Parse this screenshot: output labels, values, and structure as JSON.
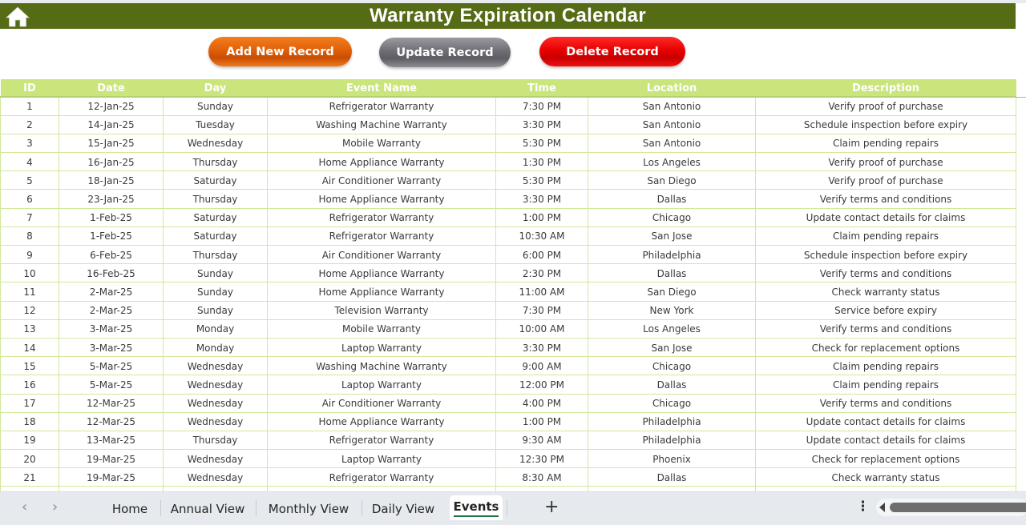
{
  "header": {
    "title": "Warranty Expiration Calendar",
    "home_icon": "home-icon",
    "colors": {
      "title_bar": "#556b15",
      "table_header": "#c9e57c",
      "grid_line": "#d2e89a"
    }
  },
  "toolbar": {
    "add_label": "Add New Record",
    "update_label": "Update Record",
    "delete_label": "Delete Record",
    "colors": {
      "add": "#e8660e",
      "update": "#6e6e74",
      "delete": "#e00000"
    }
  },
  "table": {
    "columns": [
      "ID",
      "Date",
      "Day",
      "Event Name",
      "Time",
      "Location",
      "Description"
    ],
    "rows": [
      [
        "1",
        "12-Jan-25",
        "Sunday",
        "Refrigerator Warranty",
        "7:30 PM",
        "San Antonio",
        "Verify proof of purchase"
      ],
      [
        "2",
        "14-Jan-25",
        "Tuesday",
        "Washing Machine Warranty",
        "3:30 PM",
        "San Antonio",
        "Schedule inspection before expiry"
      ],
      [
        "3",
        "15-Jan-25",
        "Wednesday",
        "Mobile Warranty",
        "5:30 PM",
        "San Antonio",
        "Claim pending repairs"
      ],
      [
        "4",
        "16-Jan-25",
        "Thursday",
        "Home Appliance Warranty",
        "1:30 PM",
        "Los Angeles",
        "Verify proof of purchase"
      ],
      [
        "5",
        "18-Jan-25",
        "Saturday",
        "Air Conditioner Warranty",
        "5:30 PM",
        "San Diego",
        "Verify proof of purchase"
      ],
      [
        "6",
        "23-Jan-25",
        "Thursday",
        "Home Appliance Warranty",
        "3:30 PM",
        "Dallas",
        "Verify terms and conditions"
      ],
      [
        "7",
        "1-Feb-25",
        "Saturday",
        "Refrigerator Warranty",
        "1:00 PM",
        "Chicago",
        "Update contact details for claims"
      ],
      [
        "8",
        "1-Feb-25",
        "Saturday",
        "Refrigerator Warranty",
        "10:30 AM",
        "San Jose",
        "Claim pending repairs"
      ],
      [
        "9",
        "6-Feb-25",
        "Thursday",
        "Air Conditioner Warranty",
        "6:00 PM",
        "Philadelphia",
        "Schedule inspection before expiry"
      ],
      [
        "10",
        "16-Feb-25",
        "Sunday",
        "Home Appliance Warranty",
        "2:30 PM",
        "Dallas",
        "Verify terms and conditions"
      ],
      [
        "11",
        "2-Mar-25",
        "Sunday",
        "Home Appliance Warranty",
        "11:00 AM",
        "San Diego",
        "Check warranty status"
      ],
      [
        "12",
        "2-Mar-25",
        "Sunday",
        "Television Warranty",
        "7:30 PM",
        "New York",
        "Service before expiry"
      ],
      [
        "13",
        "3-Mar-25",
        "Monday",
        "Mobile Warranty",
        "10:00 AM",
        "Los Angeles",
        "Verify terms and conditions"
      ],
      [
        "14",
        "3-Mar-25",
        "Monday",
        "Laptop Warranty",
        "3:30 PM",
        "San Jose",
        "Check for replacement options"
      ],
      [
        "15",
        "5-Mar-25",
        "Wednesday",
        "Washing Machine Warranty",
        "9:00 AM",
        "Chicago",
        "Claim pending repairs"
      ],
      [
        "16",
        "5-Mar-25",
        "Wednesday",
        "Laptop Warranty",
        "12:00 PM",
        "Dallas",
        "Claim pending repairs"
      ],
      [
        "17",
        "12-Mar-25",
        "Wednesday",
        "Air Conditioner Warranty",
        "4:00 PM",
        "Chicago",
        "Verify terms and conditions"
      ],
      [
        "18",
        "12-Mar-25",
        "Wednesday",
        "Home Appliance Warranty",
        "1:00 PM",
        "Philadelphia",
        "Update contact details for claims"
      ],
      [
        "19",
        "13-Mar-25",
        "Thursday",
        "Refrigerator Warranty",
        "9:30 AM",
        "Philadelphia",
        "Update contact details for claims"
      ],
      [
        "20",
        "19-Mar-25",
        "Wednesday",
        "Laptop Warranty",
        "12:30 PM",
        "Phoenix",
        "Check for replacement options"
      ],
      [
        "21",
        "19-Mar-25",
        "Wednesday",
        "Refrigerator Warranty",
        "8:30 AM",
        "Dallas",
        "Check warranty status"
      ]
    ]
  },
  "sheet_tabs": {
    "prev_icon": "‹",
    "next_icon": "›",
    "tabs": [
      {
        "label": "Home",
        "active": false
      },
      {
        "label": "Annual View",
        "active": false
      },
      {
        "label": "Monthly View",
        "active": false
      },
      {
        "label": "Daily View",
        "active": false
      },
      {
        "label": "Events",
        "active": true
      }
    ],
    "add_icon": "+",
    "more_icon": "⋮"
  }
}
